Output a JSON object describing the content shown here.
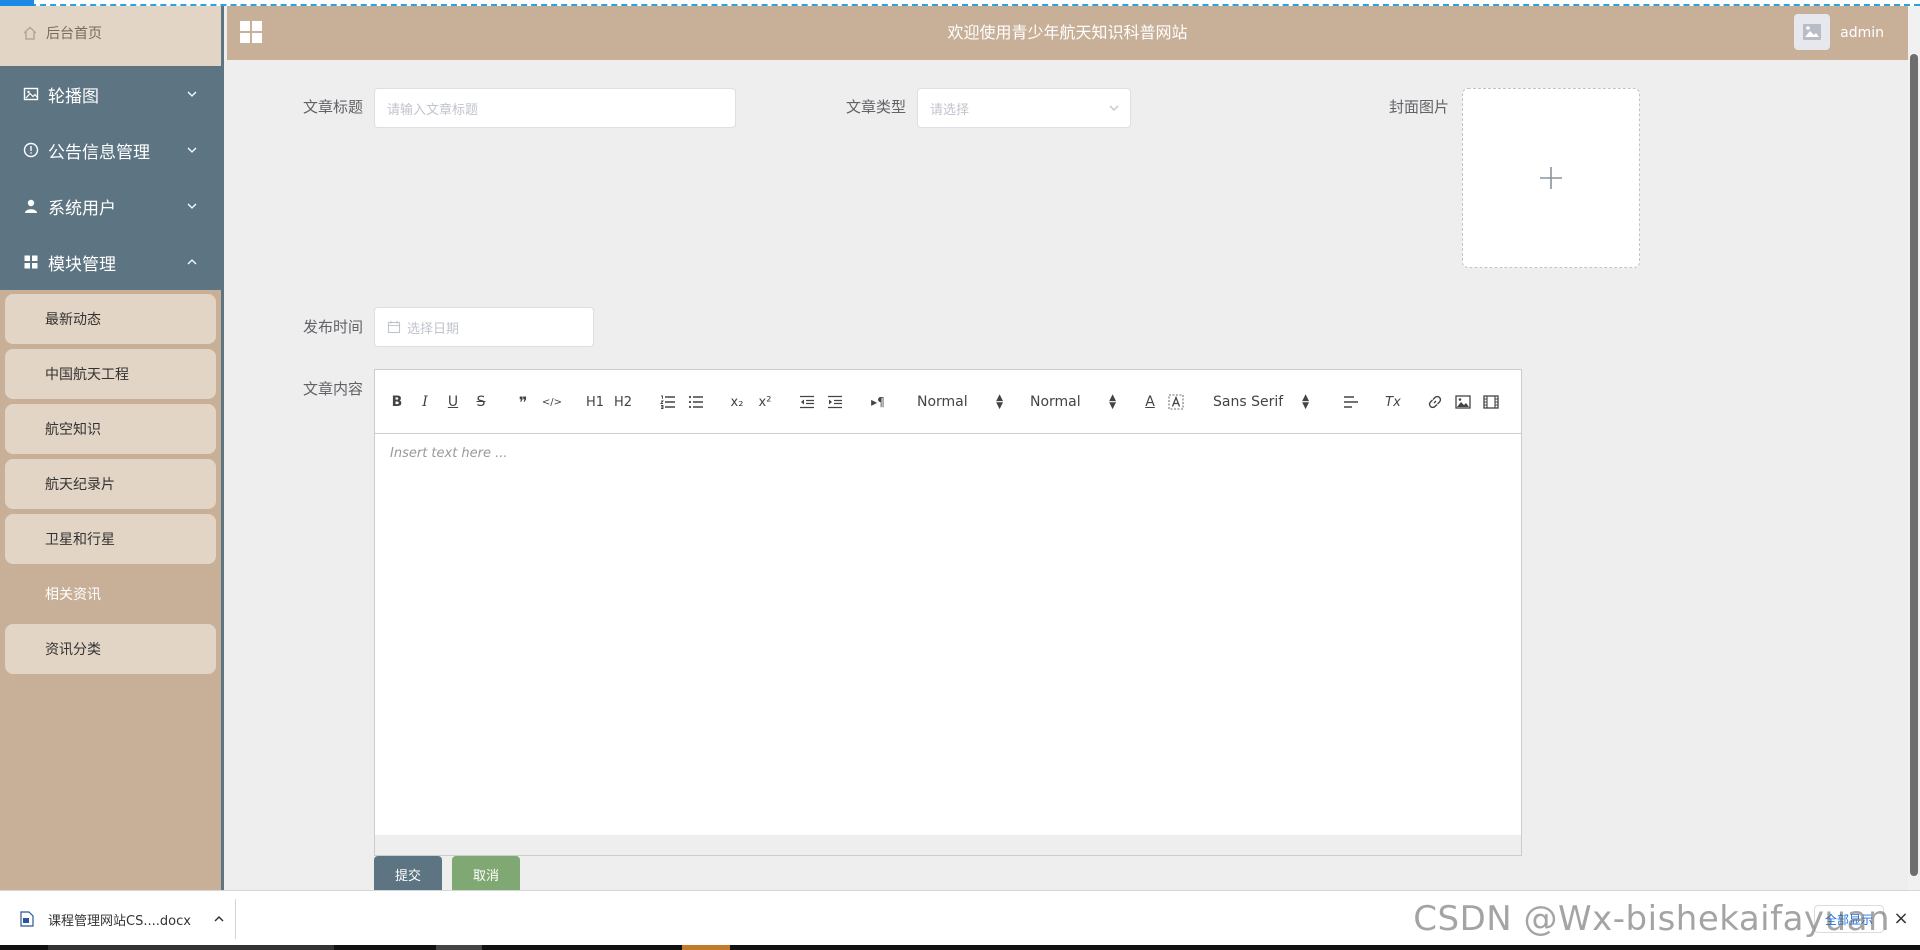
{
  "sidebar": {
    "home_label": "后台首页",
    "menus": [
      {
        "label": "轮播图",
        "icon": "image-icon",
        "expanded": false
      },
      {
        "label": "公告信息管理",
        "icon": "info-circle-icon",
        "expanded": false
      },
      {
        "label": "系统用户",
        "icon": "user-icon",
        "expanded": false
      },
      {
        "label": "模块管理",
        "icon": "grid-icon",
        "expanded": true
      }
    ],
    "submenu": [
      {
        "label": "最新动态",
        "active": false
      },
      {
        "label": "中国航天工程",
        "active": false
      },
      {
        "label": "航空知识",
        "active": false
      },
      {
        "label": "航天纪录片",
        "active": false
      },
      {
        "label": "卫星和行星",
        "active": false
      },
      {
        "label": "相关资讯",
        "active": true
      },
      {
        "label": "资讯分类",
        "active": false
      }
    ]
  },
  "header": {
    "title": "欢迎使用青少年航天知识科普网站",
    "username": "admin"
  },
  "form": {
    "title_label": "文章标题",
    "title_placeholder": "请输入文章标题",
    "type_label": "文章类型",
    "type_placeholder": "请选择",
    "cover_label": "封面图片",
    "date_label": "发布时间",
    "date_placeholder": "选择日期",
    "content_label": "文章内容",
    "submit_label": "提交",
    "cancel_label": "取消"
  },
  "editor": {
    "placeholder": "Insert text here ...",
    "header_picker": "Normal",
    "size_picker": "Normal",
    "font_picker": "Sans Serif",
    "buttons": {
      "bold": "B",
      "italic": "I",
      "underline": "U",
      "strike": "S",
      "quote": "❞",
      "code": "</>",
      "h1": "H1",
      "h2": "H2",
      "subscript": "x₂",
      "superscript": "x²",
      "direction": "▸¶",
      "color": "A",
      "clean": "Tx"
    }
  },
  "downloads": {
    "file_name": "课程管理网站CS....docx",
    "show_all": "全部显示",
    "close": "×"
  },
  "watermark": "CSDN @Wx-bishekaifayuan",
  "colors": {
    "sidebar_dark": "#5d7483",
    "tan": "#c8b098",
    "light_tan": "#e2d5c5",
    "cancel_green": "#7fa873"
  }
}
